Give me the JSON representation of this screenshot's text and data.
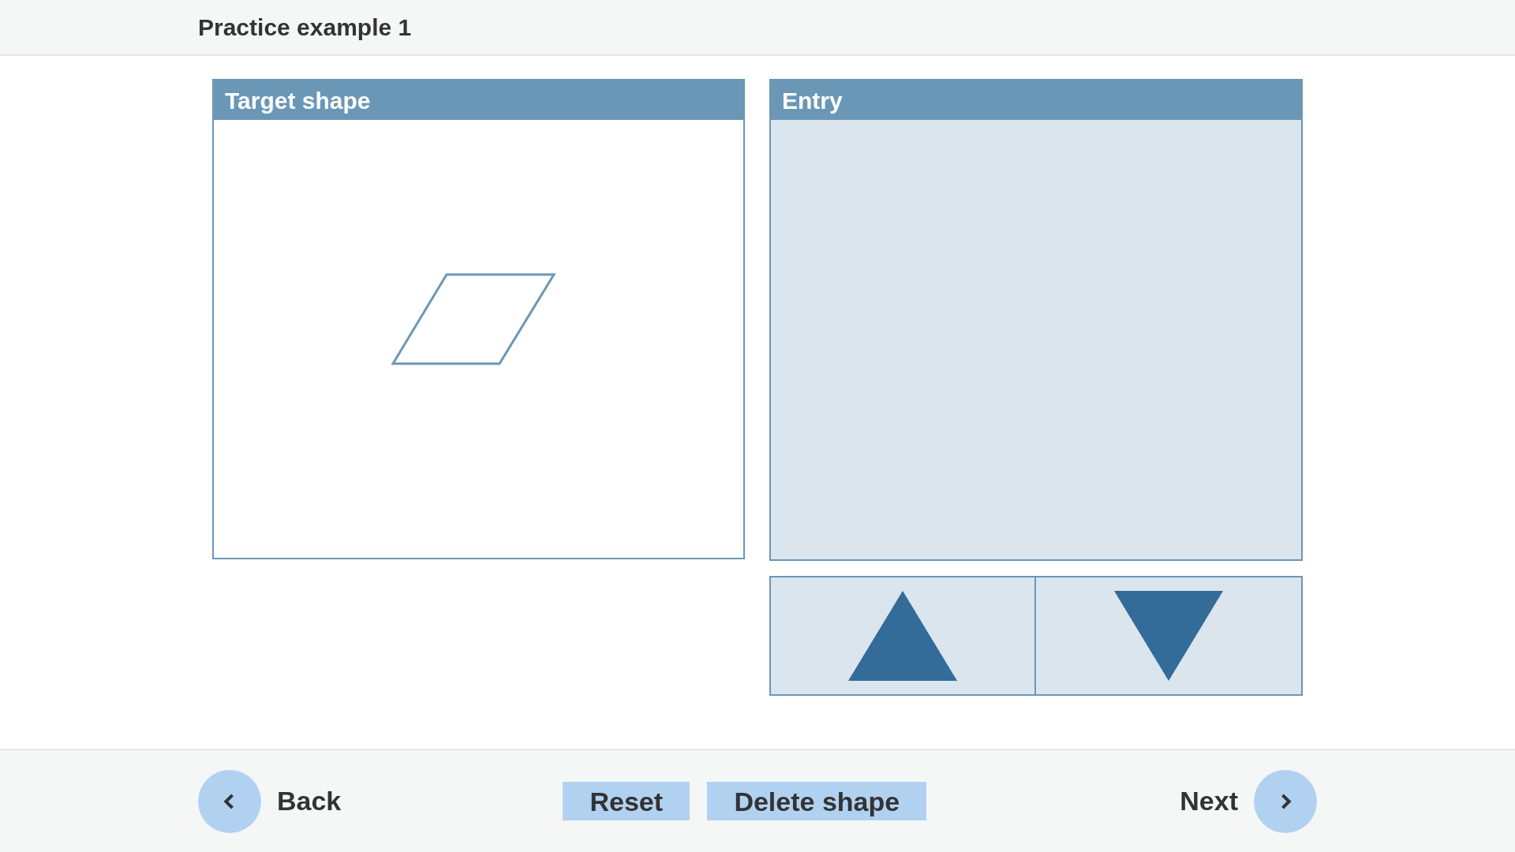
{
  "header": {
    "title": "Practice example 1"
  },
  "target_panel": {
    "title": "Target shape"
  },
  "entry_panel": {
    "title": "Entry"
  },
  "footer": {
    "back": "Back",
    "reset": "Reset",
    "delete": "Delete shape",
    "next": "Next"
  }
}
